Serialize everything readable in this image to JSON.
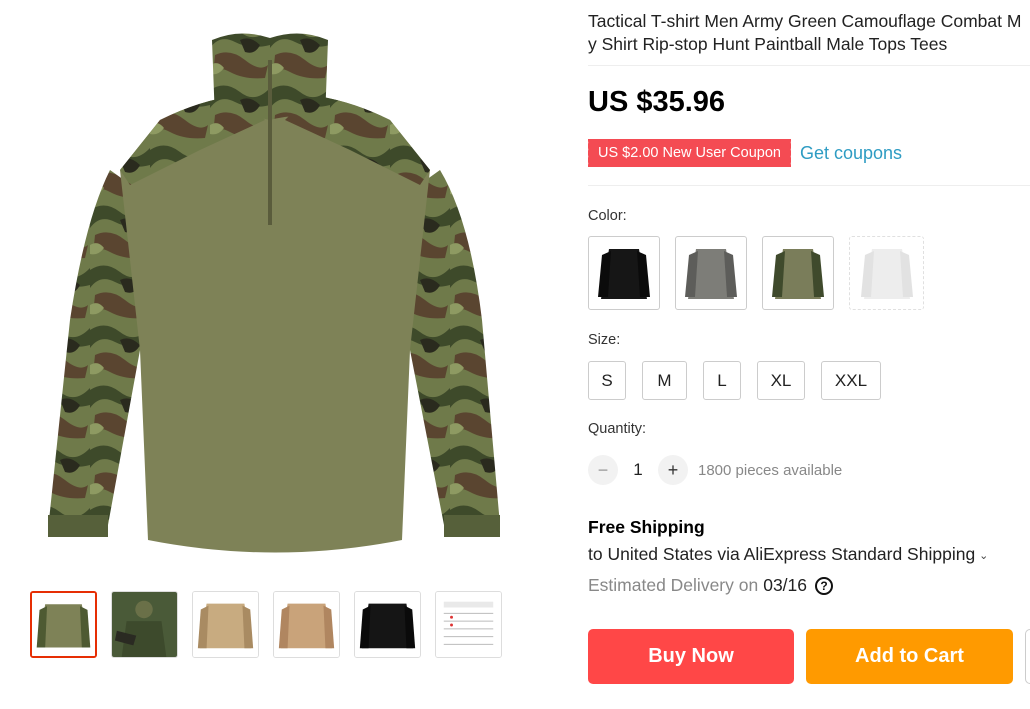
{
  "product": {
    "title_line1": "Tactical T-shirt Men Army Green Camouflage Combat M",
    "title_line2": "y Shirt Rip-stop Hunt Paintball Male Tops Tees",
    "price": "US $35.96",
    "coupon_label": "US $2.00 New User Coupon",
    "get_coupons_label": "Get coupons"
  },
  "gallery": {
    "main_image": "camouflage-shirt-image",
    "thumbnails": [
      {
        "name": "thumb-camo-shirt",
        "selected": true
      },
      {
        "name": "thumb-soldier-photo",
        "selected": false
      },
      {
        "name": "thumb-khaki-shirt",
        "selected": false
      },
      {
        "name": "thumb-tan-shirt",
        "selected": false
      },
      {
        "name": "thumb-black-shirt",
        "selected": false
      },
      {
        "name": "thumb-size-chart",
        "selected": false
      }
    ]
  },
  "color": {
    "label": "Color:",
    "options": [
      {
        "name": "black",
        "hex": "#1a1a1a"
      },
      {
        "name": "gray",
        "hex": "#7d7d78"
      },
      {
        "name": "green-camo",
        "hex": "#7a7d5a"
      },
      {
        "name": "white",
        "hex": "#dcdcdc",
        "disabled": true
      }
    ]
  },
  "size": {
    "label": "Size:",
    "options": [
      "S",
      "M",
      "L",
      "XL",
      "XXL"
    ]
  },
  "quantity": {
    "label": "Quantity:",
    "minus": "−",
    "value": "1",
    "plus": "+",
    "available": "1800 pieces available"
  },
  "shipping": {
    "title": "Free Shipping",
    "destination": "to United States via AliExpress Standard Shipping",
    "chevron": "⌄",
    "delivery_label": "Estimated Delivery on",
    "delivery_date": "03/16",
    "help_glyph": "?"
  },
  "actions": {
    "buy_now": "Buy Now",
    "add_to_cart": "Add to Cart"
  },
  "colors": {
    "accent_red": "#ff4747",
    "accent_orange": "#ff9a00",
    "coupon_red": "#f44b53",
    "link_blue": "#2e9cc3"
  }
}
